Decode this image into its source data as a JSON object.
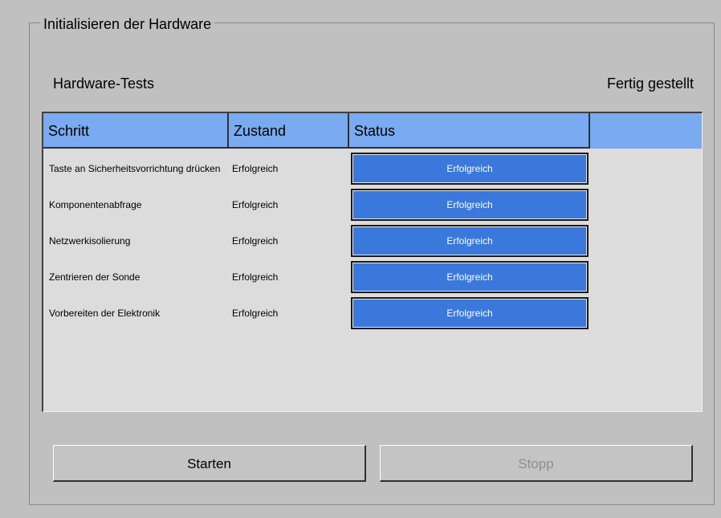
{
  "group": {
    "title": "Initialisieren der Hardware"
  },
  "section": {
    "label": "Hardware-Tests",
    "status": "Fertig gestellt"
  },
  "table": {
    "headers": [
      "Schritt",
      "Zustand",
      "Status",
      ""
    ],
    "rows": [
      {
        "step": "Taste an Sicherheitsvorrichtung drücken",
        "state": "Erfolgreich",
        "status": "Erfolgreich"
      },
      {
        "step": "Komponentenabfrage",
        "state": "Erfolgreich",
        "status": "Erfolgreich"
      },
      {
        "step": "Netzwerkisolierung",
        "state": "Erfolgreich",
        "status": "Erfolgreich"
      },
      {
        "step": "Zentrieren der Sonde",
        "state": "Erfolgreich",
        "status": "Erfolgreich"
      },
      {
        "step": "Vorbereiten der Elektronik",
        "state": "Erfolgreich",
        "status": "Erfolgreich"
      }
    ]
  },
  "buttons": {
    "start": "Starten",
    "stop": "Stopp"
  },
  "colors": {
    "background": "#c0c0c0",
    "header_bg": "#7aaaf0",
    "status_success": "#3a78db",
    "table_bg": "#dcdcdc",
    "disabled_text": "#8f8f8f"
  }
}
